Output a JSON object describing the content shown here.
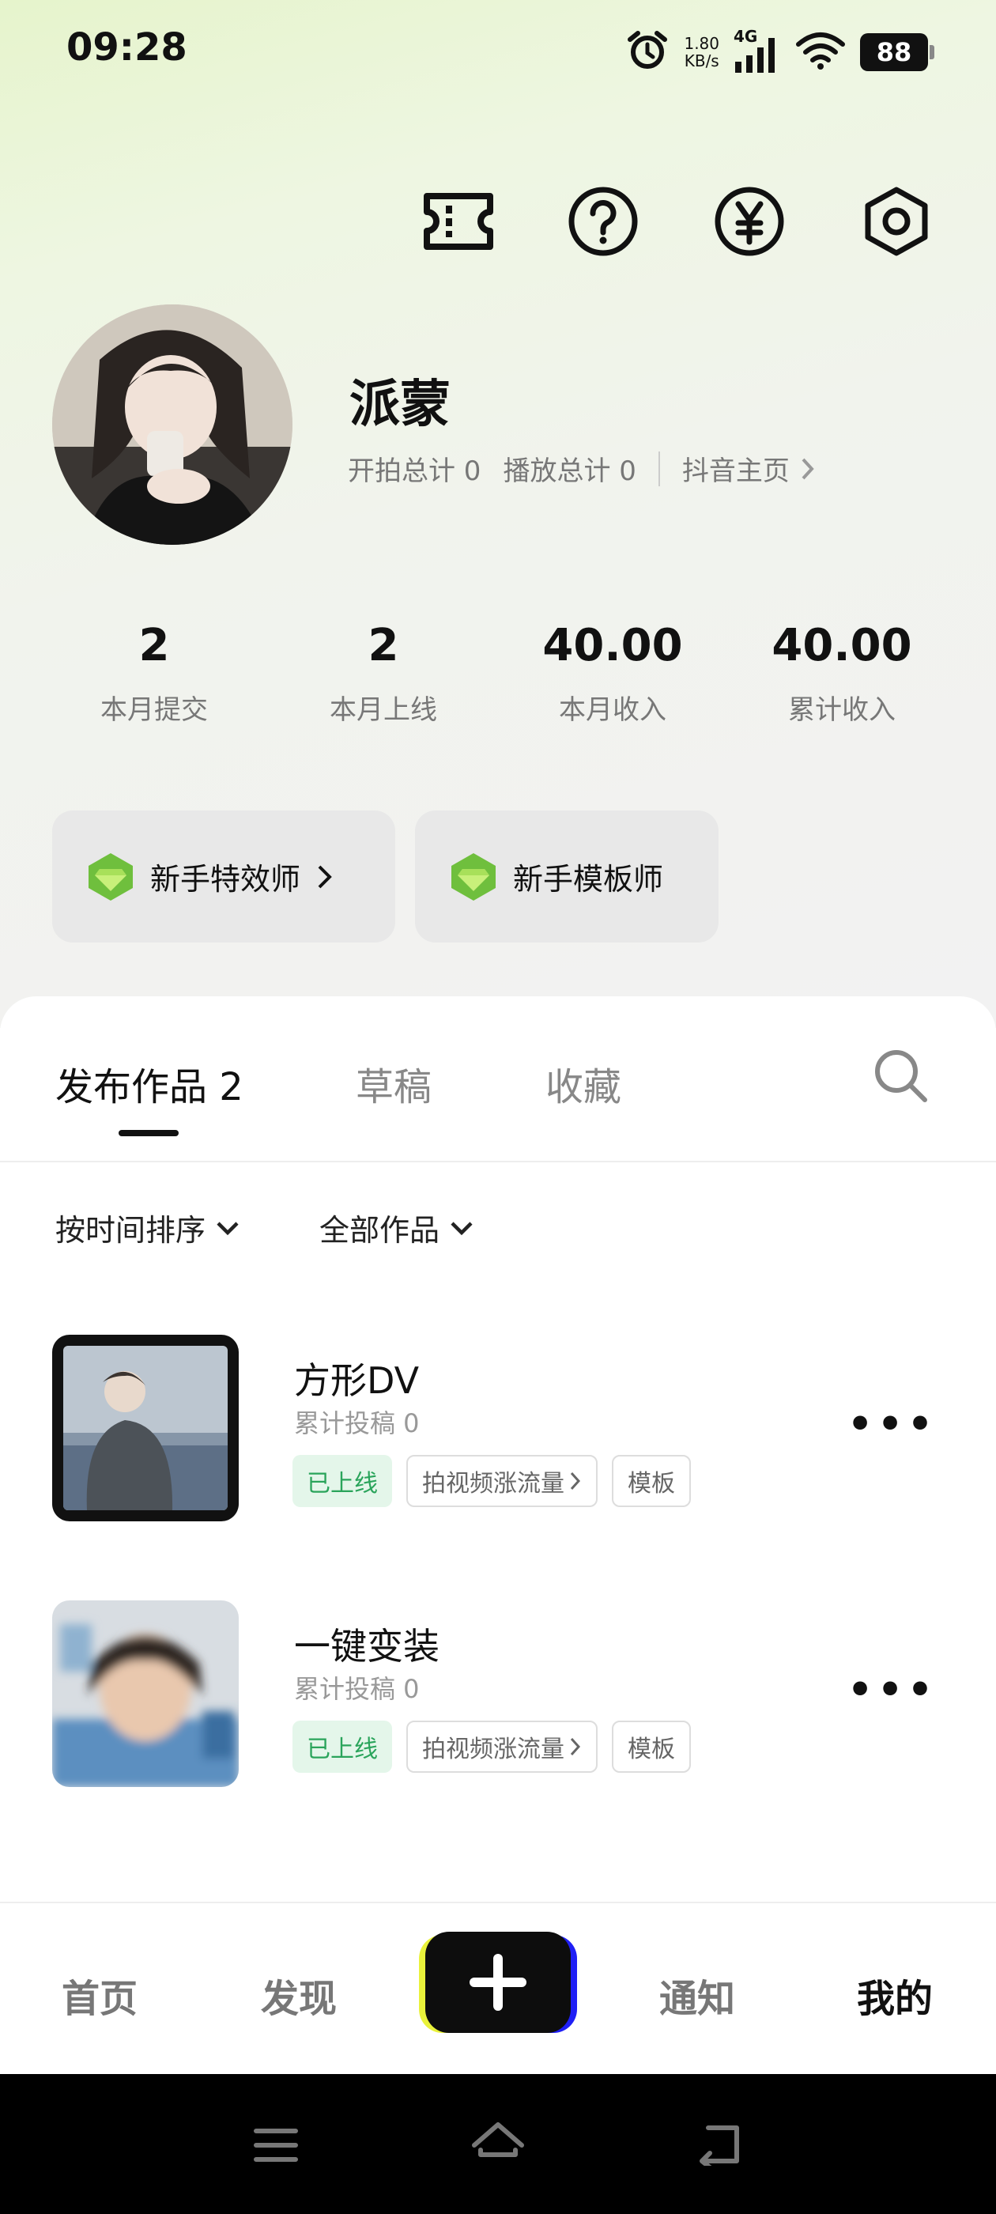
{
  "status_bar": {
    "time": "09:28",
    "network_speed_value": "1.80",
    "network_speed_unit": "KB/s",
    "network_type": "4G",
    "battery": "88",
    "icons": [
      "alarm-icon",
      "signal-icon",
      "wifi-icon",
      "battery-icon"
    ]
  },
  "top_actions": [
    "ticket-icon",
    "help-icon",
    "yuan-icon",
    "settings-icon"
  ],
  "profile": {
    "name": "派蒙",
    "shoot_total": "开拍总计 0",
    "play_total": "播放总计 0",
    "douyin_link": "抖音主页"
  },
  "stats": [
    {
      "value": "2",
      "label": "本月提交"
    },
    {
      "value": "2",
      "label": "本月上线"
    },
    {
      "value": "40.00",
      "label": "本月收入"
    },
    {
      "value": "40.00",
      "label": "累计收入"
    }
  ],
  "badges": [
    {
      "label": "新手特效师",
      "has_arrow": true
    },
    {
      "label": "新手模板师",
      "has_arrow": false
    }
  ],
  "tabs": [
    {
      "label": "发布作品 2",
      "active": true
    },
    {
      "label": "草稿",
      "active": false
    },
    {
      "label": "收藏",
      "active": false
    }
  ],
  "filters": {
    "sort": "按时间排序",
    "category": "全部作品"
  },
  "works": [
    {
      "title": "方形DV",
      "count": "累计投稿 0",
      "status": "已上线",
      "action": "拍视频涨流量",
      "type": "模板"
    },
    {
      "title": "一键变装",
      "count": "累计投稿 0",
      "status": "已上线",
      "action": "拍视频涨流量",
      "type": "模板"
    }
  ],
  "bottom_nav": {
    "home": "首页",
    "discover": "发现",
    "notify": "通知",
    "mine": "我的",
    "active": "我的"
  },
  "colors": {
    "accent_green": "#2aa45b",
    "tag_online_bg": "#e4f6ea",
    "gem_green": "#7ac943"
  }
}
